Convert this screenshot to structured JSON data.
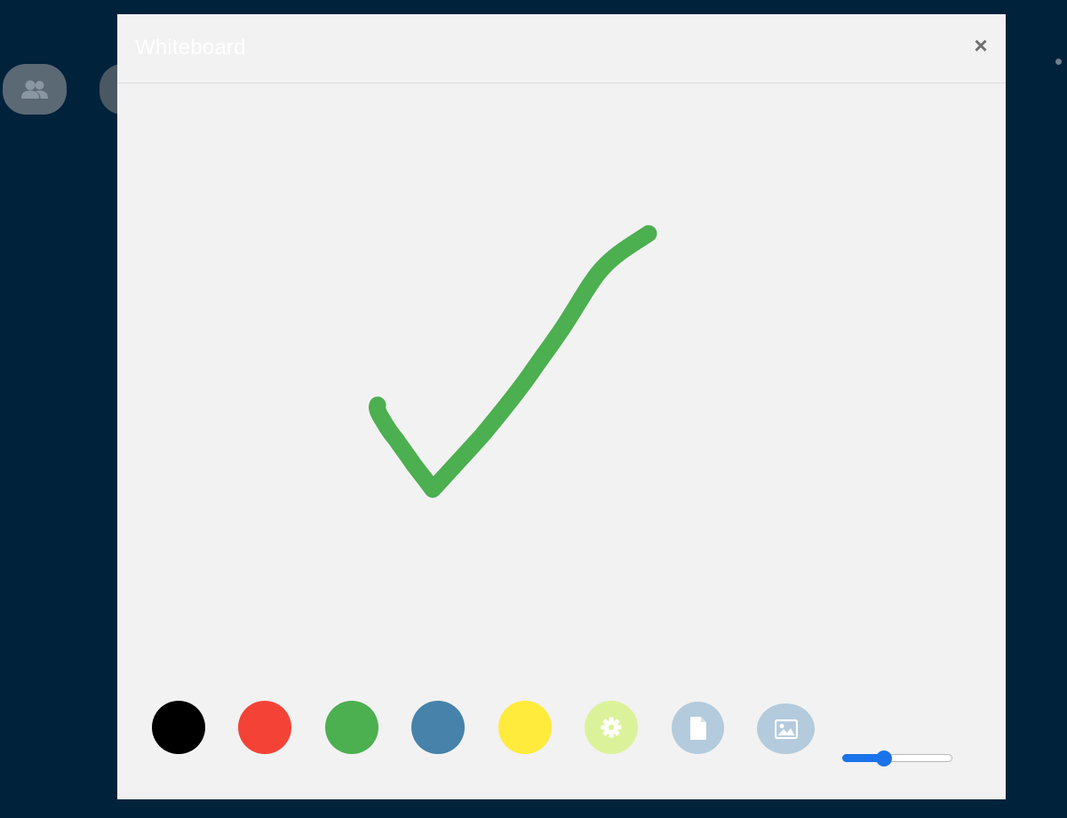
{
  "background": {
    "color": "#00223a",
    "buttons": [
      {
        "icon": "users-icon"
      },
      {
        "icon": "unknown-icon"
      }
    ]
  },
  "whiteboard": {
    "title": "Whiteboard",
    "close_label": "×",
    "drawing": {
      "stroke_color": "#4caf50",
      "shape": "checkmark"
    },
    "palette": [
      {
        "name": "black",
        "color": "#000000"
      },
      {
        "name": "red",
        "color": "#f44336"
      },
      {
        "name": "green",
        "color": "#4caf50"
      },
      {
        "name": "blue",
        "color": "#4682a9"
      },
      {
        "name": "yellow",
        "color": "#ffeb3b"
      }
    ],
    "tools": [
      {
        "name": "settings",
        "icon": "gear-icon",
        "color": "#dcf29a"
      },
      {
        "name": "save-document",
        "icon": "document-icon",
        "color": "#b3cbdc"
      },
      {
        "name": "insert-image",
        "icon": "image-icon",
        "color": "#b3cbdc"
      }
    ],
    "brush_size": {
      "value": 0.36,
      "accent": "#1a73e8"
    }
  }
}
